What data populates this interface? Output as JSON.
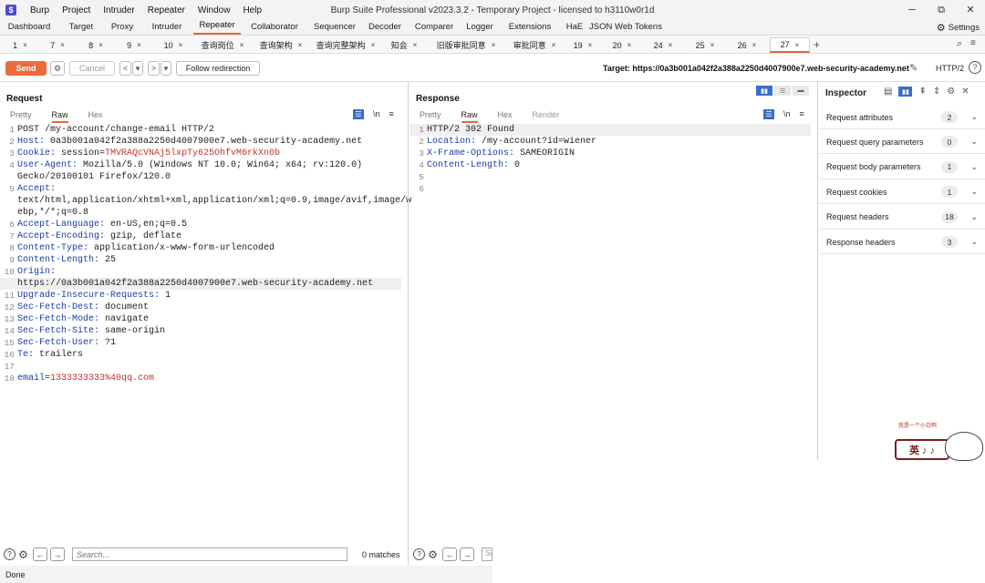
{
  "titlebar": {
    "logo": "$",
    "menu": [
      "Burp",
      "Project",
      "Intruder",
      "Repeater",
      "Window",
      "Help"
    ],
    "title": "Burp Suite Professional v2023.3.2 - Temporary Project - licensed to h3110w0r1d",
    "minimize": "─",
    "restore": "⧉",
    "close": "✕"
  },
  "tool_tabs": [
    "Dashboard",
    "Target",
    "Proxy",
    "Intruder",
    "Repeater",
    "Collaborator",
    "Sequencer",
    "Decoder",
    "Comparer",
    "Logger",
    "Extensions",
    "HaE",
    "JSON Web Tokens"
  ],
  "active_tool_tab": "Repeater",
  "settings_label": "Settings",
  "repeater_tabs": [
    "1",
    "7",
    "8",
    "9",
    "10",
    "查询岗位",
    "查询架构",
    "查询完整架构",
    "知会",
    "旧版审批同意",
    "审批同意",
    "19",
    "20",
    "24",
    "25",
    "26",
    "27"
  ],
  "active_repeater_tab": "27",
  "toolbar": {
    "send": "Send",
    "cancel": "Cancel",
    "back": "<",
    "back_drop": "▾",
    "forward": ">",
    "forward_drop": "▾",
    "follow": "Follow redirection",
    "target": "Target: https://0a3b001a042f2a388a2250d4007900e7.web-security-academy.net",
    "http_version": "HTTP/2",
    "help": "?"
  },
  "request": {
    "title": "Request",
    "subtabs": [
      "Pretty",
      "Raw",
      "Hex"
    ],
    "active_subtab": "Raw",
    "lines": [
      {
        "n": "1",
        "text": "POST /my-account/change-email HTTP/2"
      },
      {
        "n": "2",
        "key": "Host:",
        "val": " 0a3b001a042f2a388a2250d4007900e7.web-security-academy.net"
      },
      {
        "n": "3",
        "key": "Cookie:",
        "val": " session=",
        "red": "TMVRAQcVNAj5lxpTy625OhfvM6rkXn0b"
      },
      {
        "n": "4",
        "key": "User-Agent:",
        "val": " Mozilla/5.0 (Windows NT 10.0; Win64; x64; rv:120.0)"
      },
      {
        "n": "",
        "text": "Gecko/20100101 Firefox/120.0"
      },
      {
        "n": "5",
        "key": "Accept:",
        "val": ""
      },
      {
        "n": "",
        "text": "text/html,application/xhtml+xml,application/xml;q=0.9,image/avif,image/w"
      },
      {
        "n": "",
        "text": "ebp,*/*;q=0.8"
      },
      {
        "n": "6",
        "key": "Accept-Language:",
        "val": " en-US,en;q=0.5"
      },
      {
        "n": "7",
        "key": "Accept-Encoding:",
        "val": " gzip, deflate"
      },
      {
        "n": "8",
        "key": "Content-Type:",
        "val": " application/x-www-form-urlencoded"
      },
      {
        "n": "9",
        "key": "Content-Length:",
        "val": " 25"
      },
      {
        "n": "10",
        "key": "Origin:",
        "val": ""
      },
      {
        "n": "",
        "text": "https://0a3b001a042f2a388a2250d4007900e7.web-security-academy.net",
        "hl": true
      },
      {
        "n": "11",
        "key": "Upgrade-Insecure-Requests:",
        "val": " 1"
      },
      {
        "n": "12",
        "key": "Sec-Fetch-Dest:",
        "val": " document"
      },
      {
        "n": "13",
        "key": "Sec-Fetch-Mode:",
        "val": " navigate"
      },
      {
        "n": "14",
        "key": "Sec-Fetch-Site:",
        "val": " same-origin"
      },
      {
        "n": "15",
        "key": "Sec-Fetch-User:",
        "val": " ?1"
      },
      {
        "n": "16",
        "key": "Te:",
        "val": " trailers"
      },
      {
        "n": "17",
        "text": ""
      },
      {
        "n": "18",
        "key": "email",
        "val": "=",
        "red": "1333333333%40qq.com"
      }
    ]
  },
  "response": {
    "title": "Response",
    "subtabs": [
      "Pretty",
      "Raw",
      "Hex",
      "Render"
    ],
    "active_subtab": "Raw",
    "lines": [
      {
        "n": "1",
        "text": "HTTP/2 302 Found",
        "hl": true
      },
      {
        "n": "2",
        "key": "Location:",
        "val": " /my-account?id=wiener"
      },
      {
        "n": "3",
        "key": "X-Frame-Options:",
        "val": " SAMEORIGIN"
      },
      {
        "n": "4",
        "key": "Content-Length:",
        "val": " 0"
      },
      {
        "n": "5",
        "text": ""
      },
      {
        "n": "6",
        "text": ""
      }
    ]
  },
  "inspector": {
    "title": "Inspector",
    "rows": [
      {
        "label": "Request attributes",
        "count": "2"
      },
      {
        "label": "Request query parameters",
        "count": "0"
      },
      {
        "label": "Request body parameters",
        "count": "1"
      },
      {
        "label": "Request cookies",
        "count": "1"
      },
      {
        "label": "Request headers",
        "count": "18"
      },
      {
        "label": "Response headers",
        "count": "3"
      }
    ]
  },
  "sticker": {
    "caption": "我是一个小白鸭",
    "text": "英 ♪ ♪"
  },
  "search": {
    "placeholder": "Search...",
    "matches": "0 matches",
    "placeholder2": "Se"
  },
  "status": "Done"
}
